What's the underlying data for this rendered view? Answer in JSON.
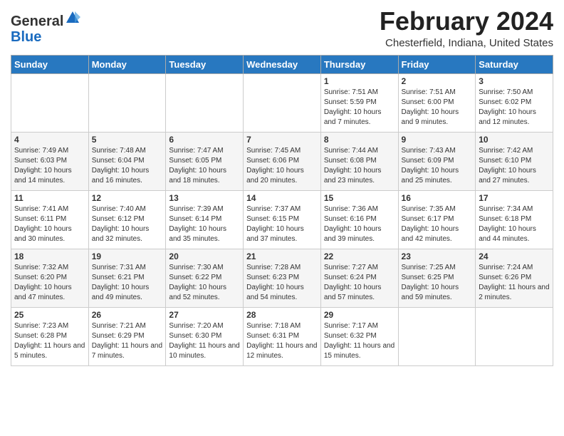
{
  "logo": {
    "general": "General",
    "blue": "Blue"
  },
  "header": {
    "month": "February 2024",
    "location": "Chesterfield, Indiana, United States"
  },
  "days_of_week": [
    "Sunday",
    "Monday",
    "Tuesday",
    "Wednesday",
    "Thursday",
    "Friday",
    "Saturday"
  ],
  "weeks": [
    [
      {
        "day": "",
        "info": ""
      },
      {
        "day": "",
        "info": ""
      },
      {
        "day": "",
        "info": ""
      },
      {
        "day": "",
        "info": ""
      },
      {
        "day": "1",
        "info": "Sunrise: 7:51 AM\nSunset: 5:59 PM\nDaylight: 10 hours and 7 minutes."
      },
      {
        "day": "2",
        "info": "Sunrise: 7:51 AM\nSunset: 6:00 PM\nDaylight: 10 hours and 9 minutes."
      },
      {
        "day": "3",
        "info": "Sunrise: 7:50 AM\nSunset: 6:02 PM\nDaylight: 10 hours and 12 minutes."
      }
    ],
    [
      {
        "day": "4",
        "info": "Sunrise: 7:49 AM\nSunset: 6:03 PM\nDaylight: 10 hours and 14 minutes."
      },
      {
        "day": "5",
        "info": "Sunrise: 7:48 AM\nSunset: 6:04 PM\nDaylight: 10 hours and 16 minutes."
      },
      {
        "day": "6",
        "info": "Sunrise: 7:47 AM\nSunset: 6:05 PM\nDaylight: 10 hours and 18 minutes."
      },
      {
        "day": "7",
        "info": "Sunrise: 7:45 AM\nSunset: 6:06 PM\nDaylight: 10 hours and 20 minutes."
      },
      {
        "day": "8",
        "info": "Sunrise: 7:44 AM\nSunset: 6:08 PM\nDaylight: 10 hours and 23 minutes."
      },
      {
        "day": "9",
        "info": "Sunrise: 7:43 AM\nSunset: 6:09 PM\nDaylight: 10 hours and 25 minutes."
      },
      {
        "day": "10",
        "info": "Sunrise: 7:42 AM\nSunset: 6:10 PM\nDaylight: 10 hours and 27 minutes."
      }
    ],
    [
      {
        "day": "11",
        "info": "Sunrise: 7:41 AM\nSunset: 6:11 PM\nDaylight: 10 hours and 30 minutes."
      },
      {
        "day": "12",
        "info": "Sunrise: 7:40 AM\nSunset: 6:12 PM\nDaylight: 10 hours and 32 minutes."
      },
      {
        "day": "13",
        "info": "Sunrise: 7:39 AM\nSunset: 6:14 PM\nDaylight: 10 hours and 35 minutes."
      },
      {
        "day": "14",
        "info": "Sunrise: 7:37 AM\nSunset: 6:15 PM\nDaylight: 10 hours and 37 minutes."
      },
      {
        "day": "15",
        "info": "Sunrise: 7:36 AM\nSunset: 6:16 PM\nDaylight: 10 hours and 39 minutes."
      },
      {
        "day": "16",
        "info": "Sunrise: 7:35 AM\nSunset: 6:17 PM\nDaylight: 10 hours and 42 minutes."
      },
      {
        "day": "17",
        "info": "Sunrise: 7:34 AM\nSunset: 6:18 PM\nDaylight: 10 hours and 44 minutes."
      }
    ],
    [
      {
        "day": "18",
        "info": "Sunrise: 7:32 AM\nSunset: 6:20 PM\nDaylight: 10 hours and 47 minutes."
      },
      {
        "day": "19",
        "info": "Sunrise: 7:31 AM\nSunset: 6:21 PM\nDaylight: 10 hours and 49 minutes."
      },
      {
        "day": "20",
        "info": "Sunrise: 7:30 AM\nSunset: 6:22 PM\nDaylight: 10 hours and 52 minutes."
      },
      {
        "day": "21",
        "info": "Sunrise: 7:28 AM\nSunset: 6:23 PM\nDaylight: 10 hours and 54 minutes."
      },
      {
        "day": "22",
        "info": "Sunrise: 7:27 AM\nSunset: 6:24 PM\nDaylight: 10 hours and 57 minutes."
      },
      {
        "day": "23",
        "info": "Sunrise: 7:25 AM\nSunset: 6:25 PM\nDaylight: 10 hours and 59 minutes."
      },
      {
        "day": "24",
        "info": "Sunrise: 7:24 AM\nSunset: 6:26 PM\nDaylight: 11 hours and 2 minutes."
      }
    ],
    [
      {
        "day": "25",
        "info": "Sunrise: 7:23 AM\nSunset: 6:28 PM\nDaylight: 11 hours and 5 minutes."
      },
      {
        "day": "26",
        "info": "Sunrise: 7:21 AM\nSunset: 6:29 PM\nDaylight: 11 hours and 7 minutes."
      },
      {
        "day": "27",
        "info": "Sunrise: 7:20 AM\nSunset: 6:30 PM\nDaylight: 11 hours and 10 minutes."
      },
      {
        "day": "28",
        "info": "Sunrise: 7:18 AM\nSunset: 6:31 PM\nDaylight: 11 hours and 12 minutes."
      },
      {
        "day": "29",
        "info": "Sunrise: 7:17 AM\nSunset: 6:32 PM\nDaylight: 11 hours and 15 minutes."
      },
      {
        "day": "",
        "info": ""
      },
      {
        "day": "",
        "info": ""
      }
    ]
  ]
}
